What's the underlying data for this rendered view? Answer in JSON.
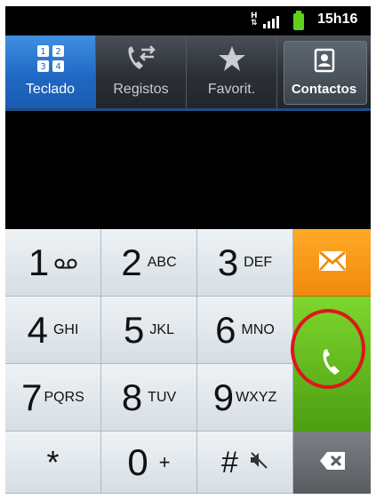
{
  "status_bar": {
    "network_type": "H",
    "time": "15h16"
  },
  "tabs": [
    {
      "label": "Teclado",
      "icon": "keypad-icon",
      "active": true
    },
    {
      "label": "Registos",
      "icon": "call-log-icon",
      "active": false
    },
    {
      "label": "Favorit.",
      "icon": "star-icon",
      "active": false
    },
    {
      "label": "Contactos",
      "icon": "contacts-icon",
      "active": false
    }
  ],
  "keypad_icon_digits": [
    "1",
    "2",
    "3",
    "4"
  ],
  "keys": [
    {
      "digit": "1",
      "letters": ""
    },
    {
      "digit": "2",
      "letters": "ABC"
    },
    {
      "digit": "3",
      "letters": "DEF"
    },
    {
      "digit": "4",
      "letters": "GHI"
    },
    {
      "digit": "5",
      "letters": "JKL"
    },
    {
      "digit": "6",
      "letters": "MNO"
    },
    {
      "digit": "7",
      "letters": "PQRS"
    },
    {
      "digit": "8",
      "letters": "TUV"
    },
    {
      "digit": "9",
      "letters": "WXYZ"
    },
    {
      "digit": "*",
      "letters": ""
    },
    {
      "digit": "0",
      "letters": "+"
    },
    {
      "digit": "#",
      "letters": ""
    }
  ],
  "side_buttons": {
    "message": "envelope-icon",
    "call": "phone-icon",
    "delete": "backspace-icon"
  },
  "colors": {
    "tab_active": "#1f66c2",
    "message_button": "#f7981a",
    "call_button": "#5fb41d",
    "highlight_circle": "#e0151d"
  }
}
